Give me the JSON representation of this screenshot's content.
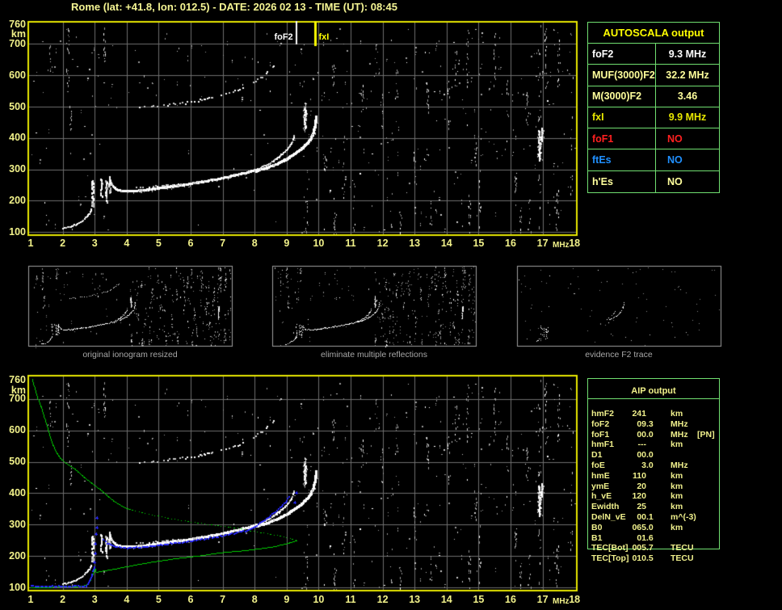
{
  "title": "Rome (lat: +41.8, lon: 012.5) - DATE: 2026 02 13 - TIME (UT): 08:45",
  "colors": {
    "background": "#000000",
    "plot_border_yellow": "#e8e800",
    "grid_grey": "#6e6e6e",
    "tick_text_yellow": "#f2f28a",
    "table_border_green": "#70df70",
    "trace_white": "#ffffff",
    "profile_green": "#00cc00",
    "fitted_trace_blue": "#2828ff",
    "marker_fxI_yellow": "#ffff00",
    "marker_foF2_white": "#ffffff",
    "caption_grey": "#a8a8a8",
    "thumb_border_grey": "#a0a0a0"
  },
  "autoscala_table": {
    "header": "AUTOSCALA output",
    "rows": [
      {
        "label": "foF2",
        "value": "9.3 MHz",
        "color": "#ffffff"
      },
      {
        "label": "MUF(3000)F2",
        "value": "32.2 MHz",
        "color": "#ffff9c"
      },
      {
        "label": "M(3000)F2",
        "value": "3.46",
        "color": "#ffff9c"
      },
      {
        "label": "fxI",
        "value": "9.9 MHz",
        "color": "#e8e800"
      },
      {
        "label": "foF1",
        "value": "NO",
        "color": "#ff2020"
      },
      {
        "label": "ftEs",
        "value": "NO",
        "color": "#2090ff"
      },
      {
        "label": "h'Es",
        "value": "NO",
        "color": "#ffff9c"
      }
    ]
  },
  "thumbnails": [
    {
      "caption": "original ionogram resized"
    },
    {
      "caption": "eliminate multiple reflections"
    },
    {
      "caption": "evidence F2 trace"
    }
  ],
  "aip_table": {
    "header": "AIP output",
    "rows": [
      {
        "name": "hmF2",
        "value": "241",
        "unit": "km",
        "extra": ""
      },
      {
        "name": "foF2",
        "value": "09.3",
        "unit": "MHz",
        "extra": ""
      },
      {
        "name": "foF1",
        "value": "00.0",
        "unit": "MHz",
        "extra": "[PN]"
      },
      {
        "name": "hmF1",
        "value": "---",
        "unit": "km",
        "extra": ""
      },
      {
        "name": "D1",
        "value": "00.0",
        "unit": "",
        "extra": ""
      },
      {
        "name": "foE",
        "value": "3.0",
        "unit": "MHz",
        "extra": ""
      },
      {
        "name": "hmE",
        "value": "110",
        "unit": "km",
        "extra": ""
      },
      {
        "name": "ymE",
        "value": "20",
        "unit": "km",
        "extra": ""
      },
      {
        "name": "h_vE",
        "value": "120",
        "unit": "km",
        "extra": ""
      },
      {
        "name": "Ewidth",
        "value": "25",
        "unit": "km",
        "extra": ""
      },
      {
        "name": "DelN_vE",
        "value": "00.1",
        "unit": "m^(-3)",
        "extra": ""
      },
      {
        "name": "B0",
        "value": "065.0",
        "unit": "km",
        "extra": ""
      },
      {
        "name": "B1",
        "value": "01.6",
        "unit": "",
        "extra": ""
      },
      {
        "name": "TEC[Bot]",
        "value": "005.7",
        "unit": "TECU",
        "extra": ""
      },
      {
        "name": "TEC[Top]",
        "value": "010.5",
        "unit": "TECU",
        "extra": ""
      }
    ]
  },
  "chart_data": {
    "type": "scatter",
    "title": "Rome ionogram autoscaled by Autoscala",
    "xlabel": "MHz",
    "ylabel": "km",
    "x_ticks": [
      1,
      2,
      3,
      4,
      5,
      6,
      7,
      8,
      9,
      10,
      11,
      12,
      13,
      14,
      15,
      16,
      17,
      18
    ],
    "y_ticks": [
      760,
      700,
      600,
      500,
      400,
      300,
      200,
      100
    ],
    "xlim": [
      1,
      18
    ],
    "ylim": [
      100,
      760
    ],
    "grid": true,
    "top_plot": {
      "markers": [
        {
          "name": "foF2",
          "frequency_mhz": 9.3,
          "color": "#ffffff"
        },
        {
          "name": "fxI",
          "frequency_mhz": 9.9,
          "color": "#ffff00"
        }
      ]
    },
    "ionogram_traces": {
      "e_tail": [
        [
          2.02,
          112
        ],
        [
          2.12,
          114
        ],
        [
          2.25,
          117
        ],
        [
          2.42,
          123
        ],
        [
          2.58,
          132
        ],
        [
          2.7,
          143
        ],
        [
          2.79,
          152
        ],
        [
          2.86,
          162
        ],
        [
          2.91,
          173
        ]
      ],
      "cusps": [
        {
          "f": 2.95,
          "km1": 183,
          "km2": 275
        },
        {
          "f": 3.22,
          "km1": 213,
          "km2": 270
        },
        {
          "f": 3.37,
          "km1": 195,
          "km2": 263
        },
        {
          "f": 3.47,
          "km1": 228,
          "km2": 277
        }
      ],
      "f_dip": [
        [
          3.47,
          270
        ],
        [
          3.52,
          254
        ],
        [
          3.58,
          245
        ],
        [
          3.66,
          238
        ],
        [
          3.75,
          233
        ],
        [
          3.85,
          231
        ]
      ],
      "o_trace": [
        [
          3.85,
          231
        ],
        [
          4.1,
          230
        ],
        [
          4.35,
          231
        ],
        [
          4.7,
          235
        ],
        [
          5.1,
          241
        ],
        [
          5.5,
          246
        ],
        [
          5.9,
          252
        ],
        [
          6.3,
          259
        ],
        [
          6.8,
          268
        ],
        [
          7.3,
          279
        ],
        [
          7.8,
          291
        ],
        [
          8.1,
          300
        ],
        [
          8.45,
          317
        ],
        [
          8.7,
          334
        ],
        [
          8.9,
          352
        ],
        [
          9.05,
          367
        ],
        [
          9.15,
          381
        ],
        [
          9.21,
          394
        ],
        [
          9.25,
          408
        ]
      ],
      "x_trace": [
        [
          8.05,
          295
        ],
        [
          8.35,
          303
        ],
        [
          8.65,
          315
        ],
        [
          8.95,
          329
        ],
        [
          9.2,
          345
        ],
        [
          9.4,
          359
        ],
        [
          9.55,
          372
        ],
        [
          9.68,
          386
        ],
        [
          9.77,
          399
        ],
        [
          9.83,
          412
        ],
        [
          9.87,
          427
        ],
        [
          9.9,
          443
        ],
        [
          9.92,
          458
        ],
        [
          9.93,
          470
        ]
      ],
      "grey_shadow": [
        [
          4.3,
          241
        ],
        [
          4.7,
          244
        ],
        [
          5.1,
          247
        ],
        [
          5.5,
          250
        ],
        [
          5.7,
          251
        ]
      ],
      "second_hop": [
        [
          4.4,
          497
        ],
        [
          4.9,
          501
        ],
        [
          5.4,
          507
        ],
        [
          5.9,
          512
        ],
        [
          6.3,
          520
        ],
        [
          6.7,
          530
        ],
        [
          7.1,
          542
        ],
        [
          7.5,
          552
        ],
        [
          7.8,
          564
        ],
        [
          8.05,
          582
        ],
        [
          8.25,
          596
        ],
        [
          8.45,
          614
        ],
        [
          8.6,
          628
        ]
      ]
    },
    "electron_density_profile_green": {
      "bottom_solid": [
        [
          1.0,
          102
        ],
        [
          1.5,
          102
        ],
        [
          2.0,
          103
        ],
        [
          2.4,
          104
        ],
        [
          2.6,
          106
        ],
        [
          2.73,
          109
        ],
        [
          2.8,
          116
        ],
        [
          2.87,
          127
        ],
        [
          2.92,
          138
        ],
        [
          2.96,
          149
        ],
        [
          2.99,
          160
        ],
        [
          3.0,
          166
        ],
        [
          3.02,
          152
        ],
        [
          3.06,
          150
        ]
      ],
      "valley_solid": [
        [
          3.06,
          150
        ],
        [
          3.2,
          153
        ],
        [
          3.5,
          158
        ],
        [
          4.0,
          168
        ],
        [
          4.7,
          181
        ],
        [
          5.5,
          193
        ],
        [
          6.25,
          202
        ],
        [
          7.0,
          213
        ],
        [
          7.62,
          218
        ],
        [
          8.1,
          224
        ],
        [
          8.6,
          231
        ],
        [
          9.07,
          243
        ],
        [
          9.3,
          250
        ]
      ],
      "topside_dotted": [
        [
          9.28,
          252
        ],
        [
          9.1,
          258
        ],
        [
          8.9,
          263
        ],
        [
          8.6,
          269
        ],
        [
          8.2,
          276
        ],
        [
          7.8,
          282
        ],
        [
          7.62,
          288
        ],
        [
          7.2,
          293
        ],
        [
          6.8,
          299
        ],
        [
          6.4,
          304
        ],
        [
          6.0,
          310
        ],
        [
          5.6,
          316
        ],
        [
          5.2,
          324
        ],
        [
          4.8,
          332
        ],
        [
          4.45,
          340
        ],
        [
          4.1,
          349
        ]
      ],
      "topside_solid": [
        [
          4.1,
          349
        ],
        [
          3.9,
          357
        ],
        [
          3.6,
          375
        ],
        [
          3.4,
          392
        ],
        [
          3.2,
          410
        ],
        [
          2.96,
          428
        ],
        [
          2.66,
          452
        ],
        [
          2.4,
          476
        ],
        [
          2.2,
          489
        ],
        [
          2.05,
          500
        ],
        [
          1.95,
          509
        ],
        [
          1.85,
          522
        ],
        [
          1.76,
          538
        ],
        [
          1.68,
          556
        ],
        [
          1.61,
          577
        ],
        [
          1.55,
          600
        ],
        [
          1.47,
          625
        ],
        [
          1.38,
          655
        ],
        [
          1.3,
          682
        ],
        [
          1.22,
          700
        ],
        [
          1.15,
          725
        ],
        [
          1.08,
          748
        ],
        [
          1.04,
          763
        ]
      ]
    },
    "fitted_trace_blue": {
      "base": [
        [
          1.02,
          104
        ],
        [
          2.73,
          104
        ]
      ],
      "e_rise": [
        [
          2.73,
          105
        ],
        [
          2.8,
          112
        ],
        [
          2.85,
          123
        ],
        [
          2.89,
          133
        ],
        [
          2.93,
          144
        ],
        [
          2.97,
          156
        ],
        [
          3.0,
          166
        ]
      ],
      "sporadic_points": [
        [
          3.0,
          181
        ],
        [
          3.02,
          209
        ],
        [
          3.03,
          240
        ],
        [
          3.05,
          270
        ],
        [
          3.06,
          292
        ],
        [
          3.07,
          322
        ],
        [
          9.26,
          371
        ],
        [
          9.32,
          402
        ]
      ],
      "f_fit": [
        [
          3.28,
          250
        ],
        [
          3.4,
          241
        ],
        [
          3.55,
          234
        ],
        [
          3.7,
          229
        ],
        [
          3.9,
          226
        ],
        [
          4.2,
          226
        ],
        [
          4.5,
          229
        ],
        [
          4.9,
          234
        ],
        [
          5.3,
          239
        ],
        [
          5.8,
          245
        ],
        [
          6.3,
          252
        ],
        [
          6.8,
          261
        ],
        [
          7.3,
          272
        ],
        [
          7.77,
          281
        ],
        [
          8.08,
          298
        ],
        [
          8.37,
          318
        ],
        [
          8.56,
          333
        ],
        [
          8.75,
          348
        ],
        [
          8.89,
          362
        ],
        [
          8.98,
          371
        ],
        [
          9.03,
          381
        ],
        [
          9.07,
          388
        ]
      ]
    },
    "noise": {
      "seed": 20260213,
      "background_count": 400,
      "streaks": [
        {
          "f": 1.6,
          "km1": 600,
          "km2": 700,
          "n": 6
        },
        {
          "f": 2.15,
          "km1": 560,
          "km2": 758,
          "n": 14
        },
        {
          "f": 2.25,
          "km1": 420,
          "km2": 520,
          "n": 8
        },
        {
          "f": 3.3,
          "km1": 640,
          "km2": 758,
          "n": 12
        },
        {
          "f": 9.57,
          "km1": 420,
          "km2": 520,
          "n": 16
        },
        {
          "f": 9.62,
          "km1": 100,
          "km2": 200,
          "n": 10
        },
        {
          "f": 10.2,
          "km1": 300,
          "km2": 380,
          "n": 6
        },
        {
          "f": 10.45,
          "km1": 560,
          "km2": 640,
          "n": 8
        },
        {
          "f": 10.5,
          "km1": 90,
          "km2": 170,
          "n": 12
        },
        {
          "f": 11.35,
          "km1": 480,
          "km2": 580,
          "n": 8
        },
        {
          "f": 11.8,
          "km1": 600,
          "km2": 700,
          "n": 6
        },
        {
          "f": 12.45,
          "km1": 520,
          "km2": 620,
          "n": 8
        },
        {
          "f": 12.55,
          "km1": 100,
          "km2": 180,
          "n": 6
        },
        {
          "f": 13.4,
          "km1": 480,
          "km2": 580,
          "n": 10
        },
        {
          "f": 13.5,
          "km1": 100,
          "km2": 200,
          "n": 6
        },
        {
          "f": 14.3,
          "km1": 560,
          "km2": 680,
          "n": 8
        },
        {
          "f": 14.65,
          "km1": 560,
          "km2": 760,
          "n": 12
        },
        {
          "f": 14.7,
          "km1": 100,
          "km2": 220,
          "n": 8
        },
        {
          "f": 14.9,
          "km1": 300,
          "km2": 420,
          "n": 8
        },
        {
          "f": 15.5,
          "km1": 560,
          "km2": 740,
          "n": 12
        },
        {
          "f": 16.15,
          "km1": 230,
          "km2": 300,
          "n": 8
        },
        {
          "f": 16.3,
          "km1": 100,
          "km2": 180,
          "n": 6
        },
        {
          "f": 16.5,
          "km1": 430,
          "km2": 560,
          "n": 10
        },
        {
          "f": 16.9,
          "km1": 100,
          "km2": 760,
          "n": 20
        },
        {
          "f": 17.1,
          "km1": 560,
          "km2": 760,
          "n": 14
        },
        {
          "f": 17.45,
          "km1": 100,
          "km2": 240,
          "n": 12
        },
        {
          "f": 17.5,
          "km1": 560,
          "km2": 720,
          "n": 10
        },
        {
          "f": 17.9,
          "km1": 100,
          "km2": 760,
          "n": 10
        },
        {
          "f": 10.8,
          "km1": 200,
          "km2": 420,
          "n": 7
        },
        {
          "f": 11.1,
          "km1": 100,
          "km2": 260,
          "n": 7
        },
        {
          "f": 12.0,
          "km1": 380,
          "km2": 560,
          "n": 7
        },
        {
          "f": 13.0,
          "km1": 200,
          "km2": 360,
          "n": 7
        },
        {
          "f": 15.05,
          "km1": 100,
          "km2": 300,
          "n": 8
        },
        {
          "f": 15.9,
          "km1": 380,
          "km2": 600,
          "n": 7
        },
        {
          "f": 16.6,
          "km1": 100,
          "km2": 220,
          "n": 6
        },
        {
          "f": 14.05,
          "km1": 420,
          "km2": 600,
          "n": 6
        }
      ],
      "bright_clusters": [
        {
          "f": 16.88,
          "km1": 330,
          "km2": 425,
          "n": 26
        },
        {
          "f": 9.57,
          "km1": 430,
          "km2": 500,
          "n": 12
        },
        {
          "f": 16.95,
          "km1": 390,
          "km2": 430,
          "n": 10
        }
      ]
    }
  }
}
